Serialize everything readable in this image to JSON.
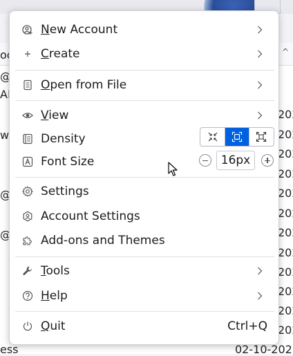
{
  "background": {
    "left_fragments": [
      "oc",
      "@",
      "AP",
      "w",
      "@",
      "@",
      "@"
    ],
    "date_fragments": [
      "202",
      "202",
      "202",
      "202",
      "202",
      "202",
      "202",
      "202",
      "202",
      "202",
      "202",
      "202",
      "202"
    ],
    "bottom_row": {
      "sender": "ess",
      "date": "02-10-202"
    }
  },
  "menu": {
    "new_account": {
      "label_first": "N",
      "label_rest": "ew Account"
    },
    "create": {
      "label_first": "C",
      "label_rest": "reate"
    },
    "open_from_file": {
      "label_first": "O",
      "label_rest": "pen from File"
    },
    "view": {
      "label_first": "V",
      "label_rest": "iew"
    },
    "density": {
      "label": "Density",
      "options": [
        "compact",
        "normal",
        "touch"
      ],
      "selected": "normal"
    },
    "font_size": {
      "label": "Font Size",
      "value": "16px"
    },
    "settings": {
      "label": "Settings"
    },
    "account_settings": {
      "label": "Account Settings"
    },
    "addons": {
      "label": "Add-ons and Themes"
    },
    "tools": {
      "label_first": "T",
      "label_rest": "ools"
    },
    "help": {
      "label_first": "H",
      "label_rest": "elp"
    },
    "quit": {
      "label_first": "Q",
      "label_rest": "uit",
      "shortcut": "Ctrl+Q"
    }
  },
  "colors": {
    "accent": "#0061e0",
    "panel": "#ffffff",
    "text": "#1b1b1f"
  }
}
